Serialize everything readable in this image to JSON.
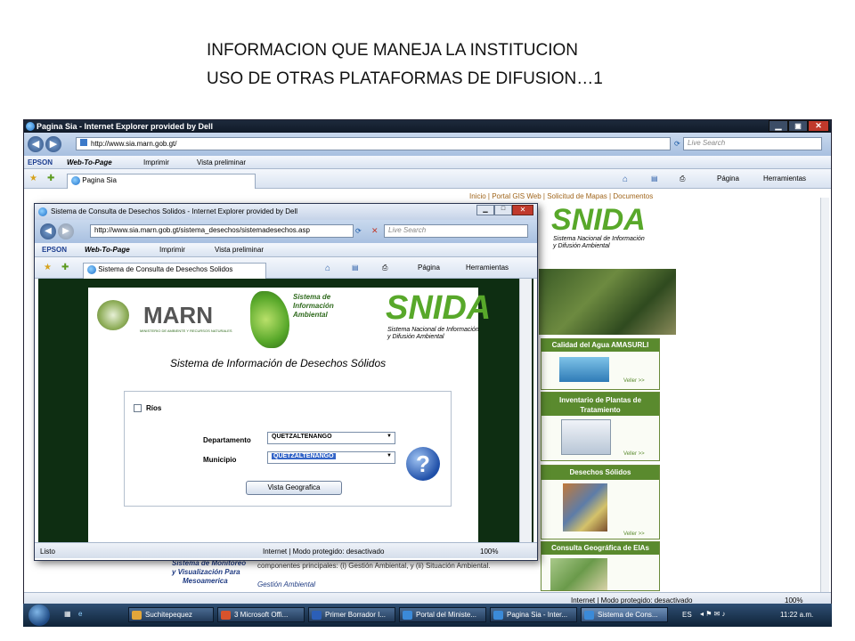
{
  "slide": {
    "title_line1": "INFORMACION QUE MANEJA LA INSTITUCION",
    "title_line2": "USO DE OTRAS PLATAFORMAS DE DIFUSION…1"
  },
  "outer_window": {
    "title": "Pagina Sia - Internet Explorer provided by Dell",
    "url": "http://www.sia.marn.gob.gt/",
    "search_placeholder": "Live Search",
    "epson_label": "EPSON",
    "web_to_page": "Web-To-Page",
    "print": "Imprimir",
    "preview": "Vista preliminar",
    "tab": "Pagina Sia",
    "pagina": "Página",
    "herramientas": "Herramientas",
    "top_links": [
      "Inicio",
      "Portal GIS Web",
      "Solicitud de Mapas",
      "Documentos"
    ],
    "snida_logo": "SNIDA",
    "snida_sub1": "Sistema Nacional de Información",
    "snida_sub2": "y Difusión Ambiental",
    "side_panels": [
      {
        "title": "Calidad del Agua AMASURLI",
        "more": "Veller >>"
      },
      {
        "title": "Inventario de Plantas de Tratamiento",
        "more": "Veller >>"
      },
      {
        "title": "Desechos Sólidos",
        "more": "Veller >>"
      },
      {
        "title": "Consulta Geográfica de EIAs",
        "more": ""
      }
    ],
    "bottom_text1": "Sistema de Monitoreo",
    "bottom_text2": "y Visualización Para",
    "bottom_text3": "Mesoamerica",
    "bottom_body": "componentes principales: (i) Gestión Ambiental, y (ii) Situación Ambiental.",
    "bottom_link": "Gestión Ambiental",
    "status_text": "Internet | Modo protegido: desactivado",
    "zoom": "100%"
  },
  "inner_window": {
    "title": "Sistema de Consulta de Desechos Solidos - Internet Explorer provided by Dell",
    "url": "http://www.sia.marn.gob.gt/sistema_desechos/sistemadesechos.asp",
    "search_placeholder": "Live Search",
    "epson_label": "EPSON",
    "web_to_page": "Web-To-Page",
    "print": "Imprimir",
    "preview": "Vista preliminar",
    "tab": "Sistema de Consulta de Desechos Solidos",
    "pagina": "Página",
    "herramientas": "Herramientas",
    "marn_logo": "MARN",
    "marn_sub": "MINISTERIO DE AMBIENTE Y RECURSOS NATURALES",
    "sia_logo_line1": "Sistema de",
    "sia_logo_line2": "Información",
    "sia_logo_line3": "Ambiental",
    "snida_logo": "SNIDA",
    "snida_sub1": "Sistema Nacional de Información",
    "snida_sub2": "y Difusión Ambiental",
    "heading": "Sistema de Información de Desechos Sólidos",
    "checkbox_label": "Ríos",
    "departamento_label": "Departamento",
    "departamento_value": "QUETZALTENANGO",
    "municipio_label": "Municipio",
    "municipio_value": "QUETZALTENANGO",
    "button_label": "Vista Geografica",
    "status_left": "Listo",
    "status_text": "Internet | Modo protegido: desactivado",
    "zoom": "100%"
  },
  "taskbar": {
    "items": [
      "Suchitepequez",
      "3 Microsoft Offi...",
      "Primer Borrador I...",
      "Portal del Ministe...",
      "Pagina Sia - Inter...",
      "Sistema de Cons..."
    ],
    "lang": "ES",
    "time": "11:22 a.m."
  },
  "colors": {
    "dark_green": "#0e2e12",
    "snida_green": "#58a82a",
    "panel_green": "#5a8a2e",
    "ie_blue": "#1f3b66"
  }
}
